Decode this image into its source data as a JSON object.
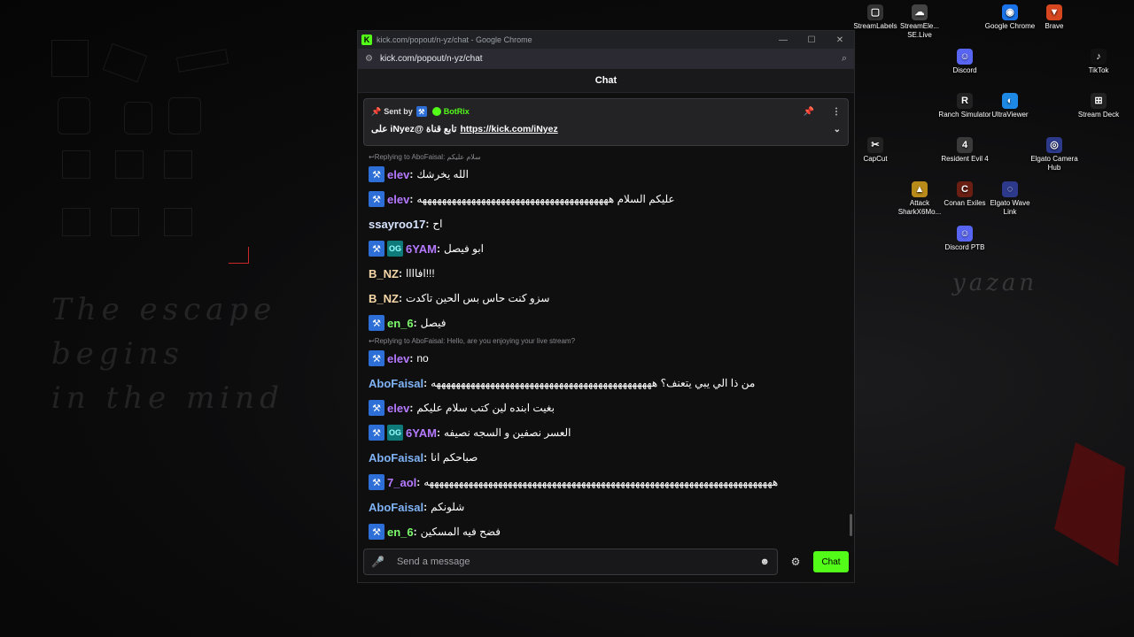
{
  "browser": {
    "title": "kick.com/popout/n-yz/chat - Google Chrome",
    "url": "kick.com/popout/n-yz/chat"
  },
  "chat": {
    "header": "Chat"
  },
  "pinned": {
    "sent_by": "Sent by",
    "bot_name": "BotRix",
    "message_prefix": "تابع قناة @iNyez على",
    "link": "https://kick.com/iNyez"
  },
  "messages": [
    {
      "reply_to": "Replying to AboFaisal: سلام عليكم",
      "user": "elev",
      "color": "#b57aff",
      "badges": [
        "mod"
      ],
      "text": "الله يخرشك"
    },
    {
      "reply_to": null,
      "user": "elev",
      "color": "#b57aff",
      "badges": [
        "mod"
      ],
      "text": "عليكم السلام هههههههههههههههههههههههههههههههههههههههه"
    },
    {
      "reply_to": null,
      "user": "ssayroo17",
      "color": "#d7e4ff",
      "badges": [],
      "text": "اح"
    },
    {
      "reply_to": null,
      "user": "6YAM",
      "color": "#b57aff",
      "badges": [
        "mod",
        "og"
      ],
      "text": "ابو فيصل"
    },
    {
      "reply_to": null,
      "user": "B_NZ",
      "color": "#f6d7a7",
      "badges": [],
      "text": "افاااا!!!"
    },
    {
      "reply_to": null,
      "user": "B_NZ",
      "color": "#f6d7a7",
      "badges": [],
      "text": "سزو كنت حاس بس الحين تاكدت"
    },
    {
      "reply_to": null,
      "user": "en_6",
      "color": "#7cfc6b",
      "badges": [
        "mod"
      ],
      "text": "فيصل"
    },
    {
      "reply_to": "Replying to AboFaisal: Hello, are you enjoying your live stream?",
      "user": "elev",
      "color": "#b57aff",
      "badges": [
        "mod"
      ],
      "text": "no"
    },
    {
      "reply_to": null,
      "user": "AboFaisal",
      "color": "#7fb3f5",
      "badges": [],
      "text": "من ذا الي يبي يتعنف؟ هههههههههههههههههههههههههههههههههههههههههههههه"
    },
    {
      "reply_to": null,
      "user": "elev",
      "color": "#b57aff",
      "badges": [
        "mod"
      ],
      "text": "بغيت ابنده لين كتب سلام عليكم"
    },
    {
      "reply_to": null,
      "user": "6YAM",
      "color": "#b57aff",
      "badges": [
        "mod",
        "og"
      ],
      "text": "العسر نصفين و السجه نصيفه"
    },
    {
      "reply_to": null,
      "user": "AboFaisal",
      "color": "#7fb3f5",
      "badges": [],
      "text": "صباحكم انا"
    },
    {
      "reply_to": null,
      "user": "7_aol",
      "color": "#b57aff",
      "badges": [
        "mod"
      ],
      "text": "هههههههههههههههههههههههههههههههههههههههههههههههههههههههههههههههههههههههه"
    },
    {
      "reply_to": null,
      "user": "AboFaisal",
      "color": "#7fb3f5",
      "badges": [],
      "text": "شلونكم"
    },
    {
      "reply_to": null,
      "user": "en_6",
      "color": "#7cfc6b",
      "badges": [
        "mod"
      ],
      "text": "فضح فيه المسكين"
    }
  ],
  "input": {
    "placeholder": "Send a message",
    "send_label": "Chat"
  },
  "desktop_icons": [
    {
      "label": "StreamLabels",
      "name": "streamlabels",
      "color": "#333333",
      "glyph": "▢"
    },
    {
      "label": "StreamEle... SE.Live",
      "name": "streamelements-selive",
      "color": "#444444",
      "glyph": "☁"
    },
    {
      "label": "Google Chrome",
      "name": "google-chrome",
      "color": "#1a73e8",
      "glyph": "◉"
    },
    {
      "label": "Brave",
      "name": "brave",
      "color": "#d6461f",
      "glyph": "▼"
    },
    {
      "label": "Discord",
      "name": "discord",
      "color": "#5865f2",
      "glyph": "☺"
    },
    {
      "label": "TikTok",
      "name": "tiktok",
      "color": "#111111",
      "glyph": "♪"
    },
    {
      "label": "Ranch Simulator",
      "name": "ranch-simulator",
      "color": "#222222",
      "glyph": "R"
    },
    {
      "label": "UltraViewer",
      "name": "ultraviewer",
      "color": "#1e88e5",
      "glyph": "◐"
    },
    {
      "label": "Stream Deck",
      "name": "stream-deck",
      "color": "#222222",
      "glyph": "⊞"
    },
    {
      "label": "CapCut",
      "name": "capcut",
      "color": "#222222",
      "glyph": "✂"
    },
    {
      "label": "Resident Evil 4",
      "name": "resident-evil-4",
      "color": "#3a3a3a",
      "glyph": "4"
    },
    {
      "label": "Elgato Camera Hub",
      "name": "elgato-camera-hub",
      "color": "#2d3a8c",
      "glyph": "◎"
    },
    {
      "label": "Attack SharkX6Mo...",
      "name": "attack-shark",
      "color": "#b88a1a",
      "glyph": "▲"
    },
    {
      "label": "Conan Exiles",
      "name": "conan-exiles",
      "color": "#6b1e12",
      "glyph": "C"
    },
    {
      "label": "Elgato Wave Link",
      "name": "elgato-wave-link",
      "color": "#2d3a8c",
      "glyph": "◌"
    },
    {
      "label": "Discord PTB",
      "name": "discord-ptb",
      "color": "#5865f2",
      "glyph": "☺"
    }
  ],
  "wallpaper": {
    "text_lines": [
      "The escape",
      "begins",
      "in the mind"
    ],
    "logo": "yazan"
  }
}
